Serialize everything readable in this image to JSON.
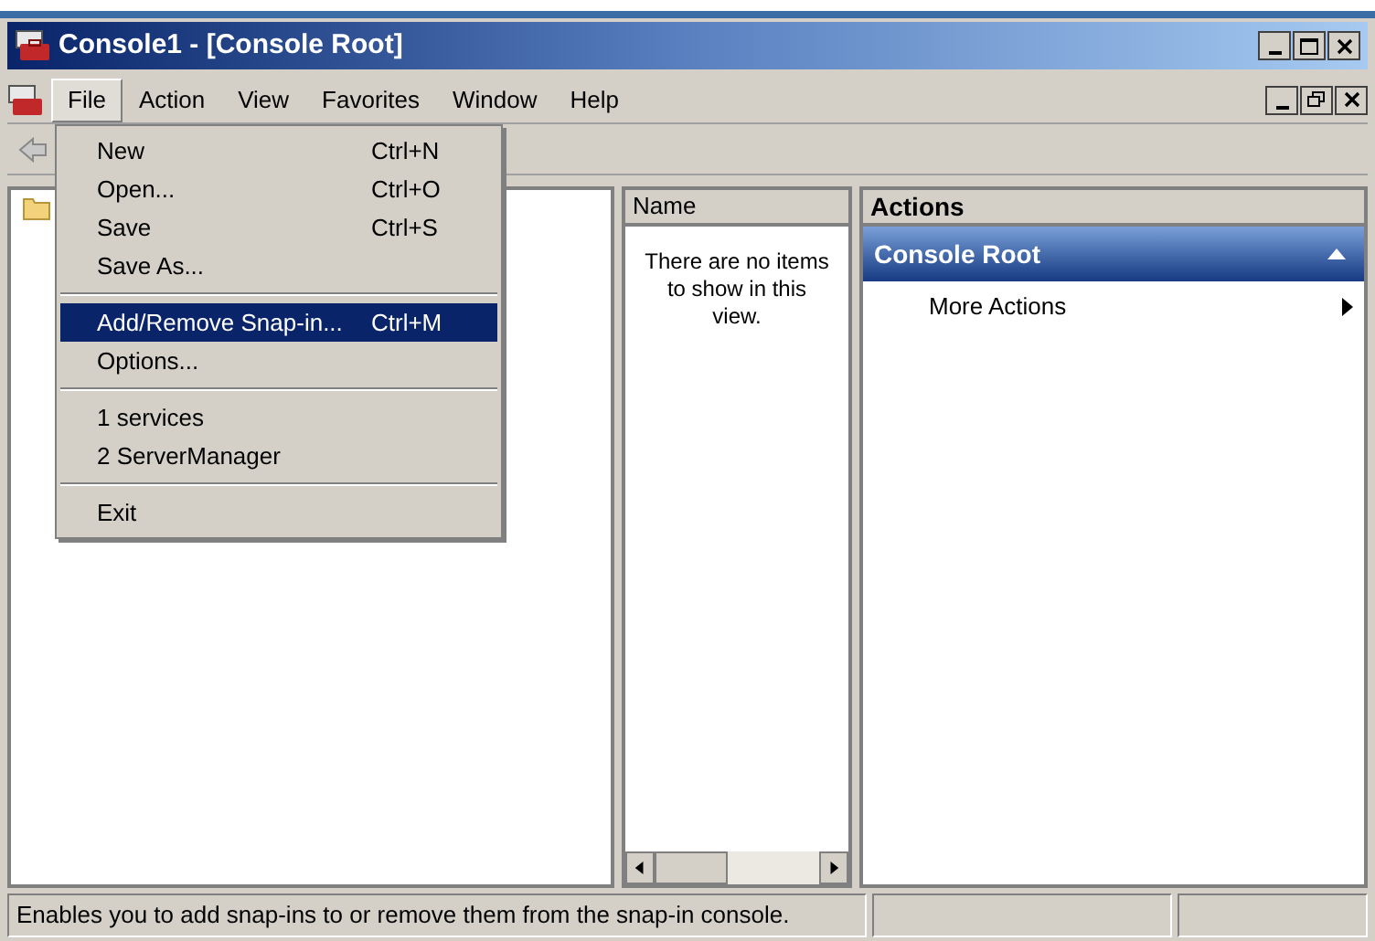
{
  "window": {
    "title": "Console1 - [Console Root]"
  },
  "menu_bar": [
    {
      "label": "File",
      "selected": true
    },
    {
      "label": "Action",
      "selected": false
    },
    {
      "label": "View",
      "selected": false
    },
    {
      "label": "Favorites",
      "selected": false
    },
    {
      "label": "Window",
      "selected": false
    },
    {
      "label": "Help",
      "selected": false
    }
  ],
  "file_menu": [
    {
      "kind": "item",
      "label": "New",
      "shortcut": "Ctrl+N",
      "selected": false
    },
    {
      "kind": "item",
      "label": "Open...",
      "shortcut": "Ctrl+O",
      "selected": false
    },
    {
      "kind": "item",
      "label": "Save",
      "shortcut": "Ctrl+S",
      "selected": false
    },
    {
      "kind": "item",
      "label": "Save As...",
      "selected": false
    },
    {
      "kind": "separator"
    },
    {
      "kind": "item",
      "label": "Add/Remove Snap-in...",
      "shortcut": "Ctrl+M",
      "selected": true
    },
    {
      "kind": "item",
      "label": "Options...",
      "selected": false
    },
    {
      "kind": "separator"
    },
    {
      "kind": "item",
      "label": "1 services",
      "selected": false
    },
    {
      "kind": "item",
      "label": "2 ServerManager",
      "selected": false
    },
    {
      "kind": "separator"
    },
    {
      "kind": "item",
      "label": "Exit",
      "selected": false
    }
  ],
  "list_pane": {
    "column": "Name",
    "empty_message": "There are no items to show in this view."
  },
  "actions_pane": {
    "title": "Actions",
    "section": "Console Root",
    "items": [
      "More Actions"
    ]
  },
  "status_bar": [
    "Enables you to add snap-ins to or remove them from the snap-in console."
  ]
}
